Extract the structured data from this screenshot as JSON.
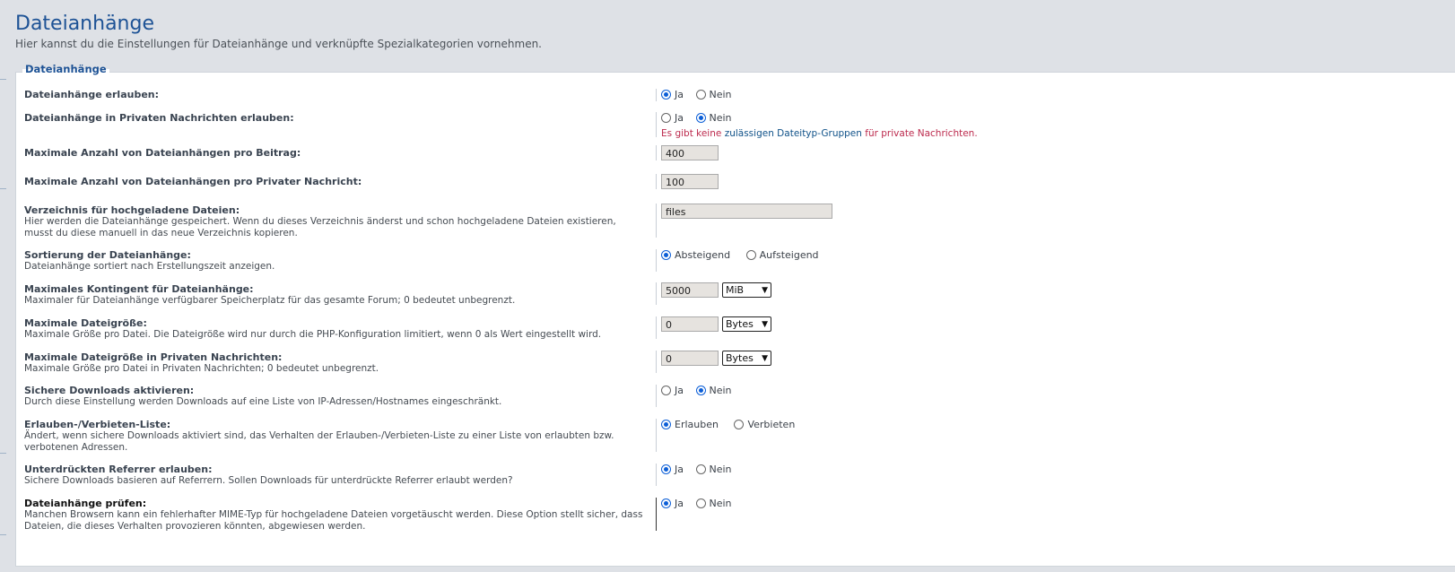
{
  "header": {
    "title": "Dateianhänge",
    "description": "Hier kannst du die Einstellungen für Dateianhänge und verknüpfte Spezialkategorien vornehmen."
  },
  "fieldset": {
    "legend": "Dateianhänge"
  },
  "settings": [
    {
      "label": "Dateianhänge erlauben:",
      "options": [
        "Ja",
        "Nein"
      ],
      "selected": "Ja"
    },
    {
      "label": "Dateianhänge in Privaten Nachrichten erlauben:",
      "options": [
        "Ja",
        "Nein"
      ],
      "selected": "Nein",
      "warning": {
        "part1": "Es gibt keine ",
        "link": "zulässigen Dateityp-Gruppen",
        "part2": " für private Nachrichten."
      }
    },
    {
      "label": "Maximale Anzahl von Dateianhängen pro Beitrag:",
      "value": "400"
    },
    {
      "label": "Maximale Anzahl von Dateianhängen pro Privater Nachricht:",
      "value": "100"
    },
    {
      "label": "Verzeichnis für hochgeladene Dateien:",
      "description": "Hier werden die Dateianhänge gespeichert. Wenn du dieses Verzeichnis änderst und schon hochgeladene Dateien existieren, musst du diese manuell in das neue Verzeichnis kopieren.",
      "value": "files"
    },
    {
      "label": "Sortierung der Dateianhänge:",
      "description": "Dateianhänge sortiert nach Erstellungszeit anzeigen.",
      "options": [
        "Absteigend",
        "Aufsteigend"
      ],
      "selected": "Absteigend"
    },
    {
      "label": "Maximales Kontingent für Dateianhänge:",
      "description": "Maximaler für Dateianhänge verfügbarer Speicherplatz für das gesamte Forum; 0 bedeutet unbegrenzt.",
      "value": "5000",
      "unit": "MiB"
    },
    {
      "label": "Maximale Dateigröße:",
      "description": "Maximale Größe pro Datei. Die Dateigröße wird nur durch die PHP-Konfiguration limitiert, wenn 0 als Wert eingestellt wird.",
      "value": "0",
      "unit": "Bytes"
    },
    {
      "label": "Maximale Dateigröße in Privaten Nachrichten:",
      "description": "Maximale Größe pro Datei in Privaten Nachrichten; 0 bedeutet unbegrenzt.",
      "value": "0",
      "unit": "Bytes"
    },
    {
      "label": "Sichere Downloads aktivieren:",
      "description": "Durch diese Einstellung werden Downloads auf eine Liste von IP-Adressen/Hostnames eingeschränkt.",
      "options": [
        "Ja",
        "Nein"
      ],
      "selected": "Nein"
    },
    {
      "label": "Erlauben-/Verbieten-Liste:",
      "description": "Ändert, wenn sichere Downloads aktiviert sind, das Verhalten der Erlauben-/Verbieten-Liste zu einer Liste von erlaubten bzw. verbotenen Adressen.",
      "options": [
        "Erlauben",
        "Verbieten"
      ],
      "selected": "Erlauben"
    },
    {
      "label": "Unterdrückten Referrer erlauben:",
      "description": "Sichere Downloads basieren auf Referrern. Sollen Downloads für unterdrückte Referrer erlaubt werden?",
      "options": [
        "Ja",
        "Nein"
      ],
      "selected": "Ja"
    },
    {
      "label": "Dateianhänge prüfen:",
      "description": "Manchen Browsern kann ein fehlerhafter MIME-Typ für hochgeladene Dateien vorgetäuscht werden. Diese Option stellt sicher, dass Dateien, die dieses Verhalten provozieren könnten, abgewiesen werden.",
      "options": [
        "Ja",
        "Nein"
      ],
      "selected": "Ja"
    }
  ]
}
